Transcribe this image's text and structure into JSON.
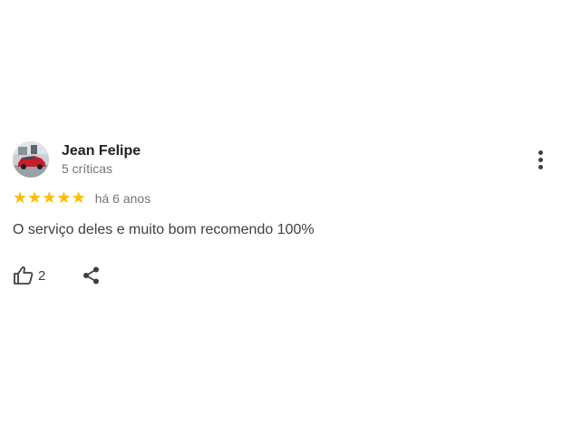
{
  "review": {
    "author": {
      "name": "Jean Felipe",
      "meta": "5 críticas",
      "avatar_icon": "user-photo-red-car"
    },
    "rating": {
      "value": 5,
      "max": 5,
      "star_glyph": "★",
      "star_color": "#fbbc04"
    },
    "date": "há 6 anos",
    "text": "O serviço deles e muito bom recomendo 100%",
    "actions": {
      "like_icon": "thumb-up-icon",
      "like_count": "2",
      "share_icon": "share-icon",
      "more_icon": "more-vert-icon"
    }
  }
}
